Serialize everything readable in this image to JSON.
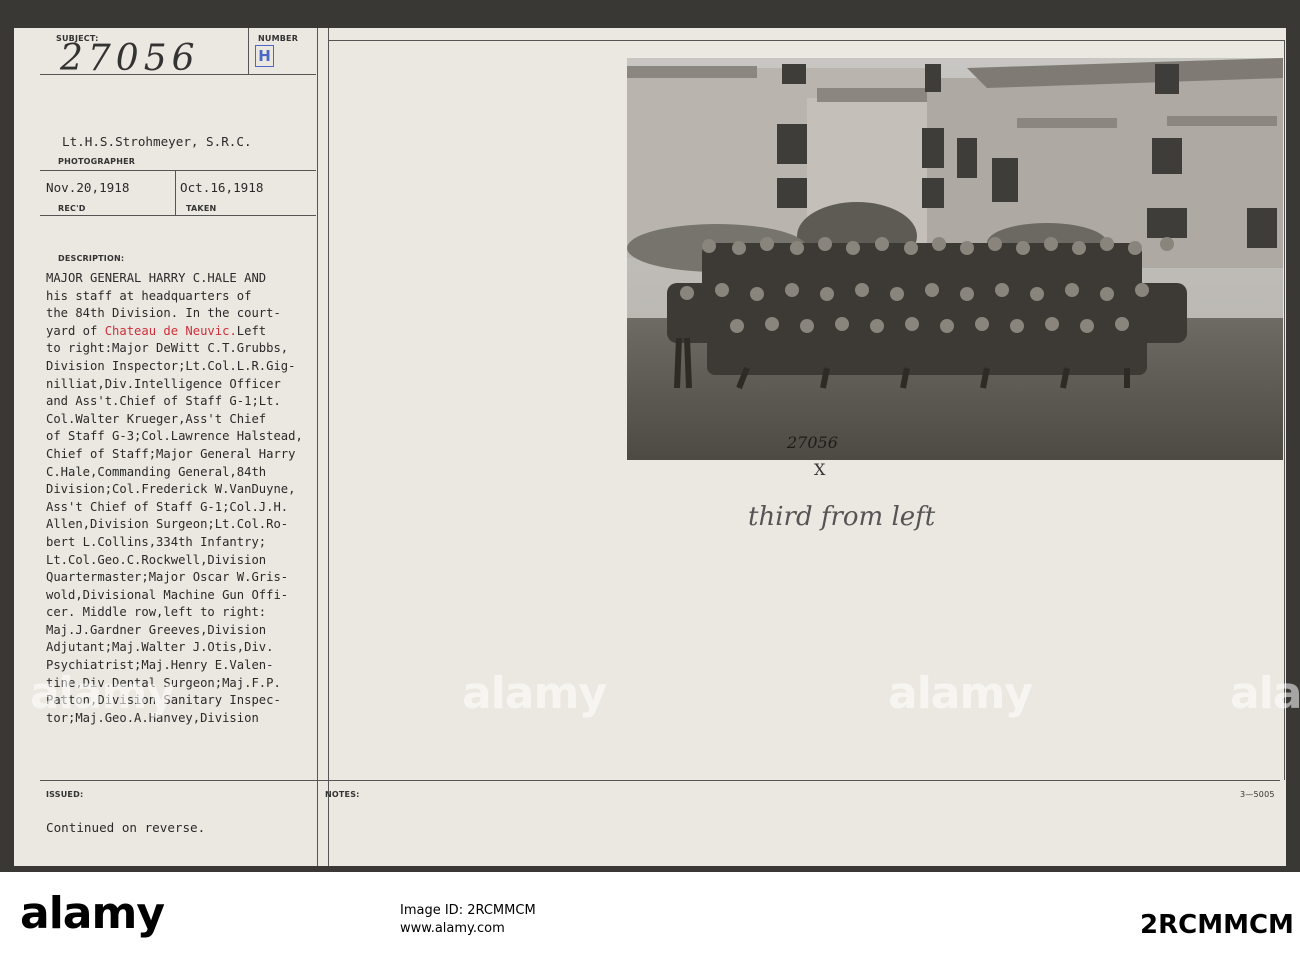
{
  "card": {
    "subject_label": "SUBJECT:",
    "subject_value": "27056",
    "number_label": "NUMBER",
    "number_value": "H",
    "photographer_value": "Lt.H.S.Strohmeyer, S.R.C.",
    "photographer_label": "PHOTOGRAPHER",
    "recd_value": "Nov.20,1918",
    "recd_label": "REC'D",
    "taken_value": "Oct.16,1918",
    "taken_label": "TAKEN",
    "description_label": "DESCRIPTION:",
    "description_lines": [
      {
        "pre": "MAJOR GENERAL HARRY C.HALE AND",
        "red": "",
        "post": ""
      },
      {
        "pre": "his staff at headquarters of",
        "red": "",
        "post": ""
      },
      {
        "pre": "the 84th Division. In the court-",
        "red": "",
        "post": ""
      },
      {
        "pre": "yard of ",
        "red": "Chateau de Neuvic.",
        "post": "Left"
      },
      {
        "pre": "to right:Major DeWitt C.T.Grubbs,",
        "red": "",
        "post": ""
      },
      {
        "pre": "Division Inspector;Lt.Col.L.R.Gig-",
        "red": "",
        "post": ""
      },
      {
        "pre": "nilliat,Div.Intelligence Officer",
        "red": "",
        "post": ""
      },
      {
        "pre": "and Ass't.Chief of Staff G-1;Lt.",
        "red": "",
        "post": ""
      },
      {
        "pre": "Col.Walter Krueger,Ass't Chief",
        "red": "",
        "post": ""
      },
      {
        "pre": "of Staff G-3;Col.Lawrence Halstead,",
        "red": "",
        "post": ""
      },
      {
        "pre": "Chief of Staff;Major General Harry",
        "red": "",
        "post": ""
      },
      {
        "pre": "C.Hale,Commanding General,84th",
        "red": "",
        "post": ""
      },
      {
        "pre": "Division;Col.Frederick W.VanDuyne,",
        "red": "",
        "post": ""
      },
      {
        "pre": "Ass't Chief of Staff G-1;Col.J.H.",
        "red": "",
        "post": ""
      },
      {
        "pre": "Allen,Division Surgeon;Lt.Col.Ro-",
        "red": "",
        "post": ""
      },
      {
        "pre": "bert L.Collins,334th Infantry;",
        "red": "",
        "post": ""
      },
      {
        "pre": "Lt.Col.Geo.C.Rockwell,Division",
        "red": "",
        "post": ""
      },
      {
        "pre": "Quartermaster;Major Oscar W.Gris-",
        "red": "",
        "post": ""
      },
      {
        "pre": "wold,Divisional Machine Gun Offi-",
        "red": "",
        "post": ""
      },
      {
        "pre": "cer. Middle row,left to right:",
        "red": "",
        "post": ""
      },
      {
        "pre": "Maj.J.Gardner Greeves,Division",
        "red": "",
        "post": ""
      },
      {
        "pre": "Adjutant;Maj.Walter J.Otis,Div.",
        "red": "",
        "post": ""
      },
      {
        "pre": "Psychiatrist;Maj.Henry E.Valen-",
        "red": "",
        "post": ""
      },
      {
        "pre": "tine,Div.Dental Surgeon;Maj.F.P.",
        "red": "",
        "post": ""
      },
      {
        "pre": "Patton,Division Sanitary Inspec-",
        "red": "",
        "post": ""
      },
      {
        "pre": "tor;Maj.Geo.A.Hanvey,Division",
        "red": "",
        "post": ""
      }
    ],
    "issued_label": "ISSUED:",
    "notes_label": "NOTES:",
    "continued": "Continued on reverse.",
    "form_code": "3—5005",
    "photo_number": "27056",
    "handwritten_mark": "X",
    "handwritten_note": "third from left"
  },
  "watermarks": [
    "alamy",
    "alamy",
    "alamy",
    "alamy"
  ],
  "bottom_bar": {
    "logo": "alamy",
    "line1": "Image ID: 2RCMMCM",
    "line2": "www.alamy.com",
    "code": "2RCMMCM"
  },
  "colors": {
    "card": "#ebe8e1",
    "red_text": "#cc2f3b",
    "number_blue": "#4b69c4"
  }
}
